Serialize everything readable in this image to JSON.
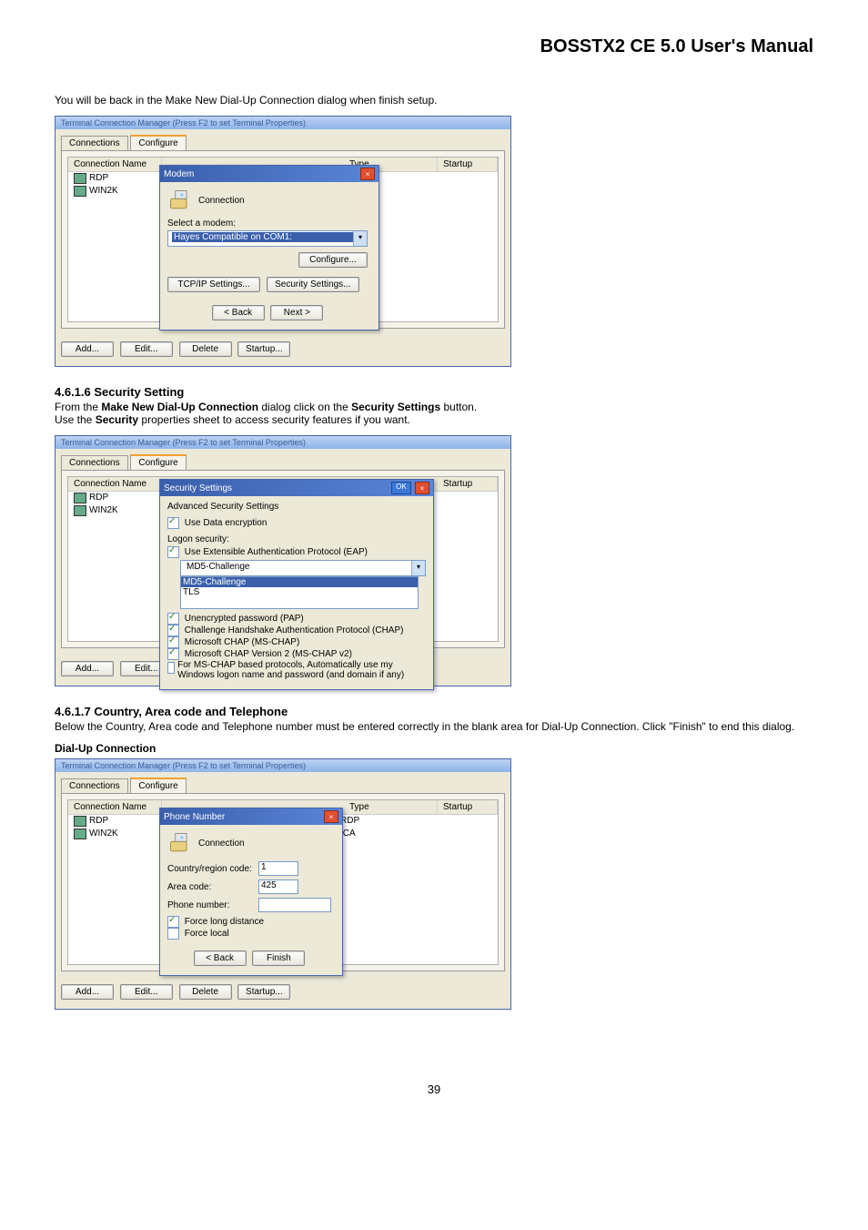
{
  "doc": {
    "title": "BOSSTX2 CE 5.0 User's Manual",
    "intro_text": "You will be back in the Make New Dial-Up Connection dialog when finish setup.",
    "page_number": "39"
  },
  "sec4616": {
    "heading": "4.6.1.6  Security Setting",
    "text1_prefix": "From the ",
    "text1_bold1": "Make New Dial-Up Connection",
    "text1_mid": " dialog click on the ",
    "text1_bold2": "Security Settings",
    "text1_suffix": " button.",
    "text2_prefix": "Use the ",
    "text2_bold": "Security",
    "text2_suffix": " properties sheet to access security features if you want."
  },
  "sec4617": {
    "heading": "4.6.1.7  Country, Area code and Telephone",
    "text": "Below the Country, Area code and Telephone number must be entered correctly in the blank area for Dial-Up Connection. Click \"Finish\" to end this dialog.",
    "subheading": "Dial-Up Connection"
  },
  "tcm": {
    "titlebar": "Terminal Connection Manager (Press F2 to set Terminal Properties)",
    "tabs": {
      "connections": "Connections",
      "configure": "Configure"
    },
    "headers": {
      "name": "Connection Name",
      "type": "Type",
      "startup": "Startup"
    },
    "rows": [
      {
        "name": "RDP",
        "type": "RDP"
      },
      {
        "name": "WIN2K",
        "type": "ICA"
      }
    ],
    "buttons": {
      "add": "Add...",
      "edit": "Edit...",
      "delete": "Delete",
      "startup": "Startup..."
    }
  },
  "modem_popup": {
    "title": "Modem",
    "label_connection": "Connection",
    "select_modem": "Select a modem:",
    "selected_modem": "Hayes Compatible on COM1:",
    "btn_configure": "Configure...",
    "btn_tcpip": "TCP/IP Settings...",
    "btn_security": "Security Settings...",
    "btn_back": "< Back",
    "btn_next": "Next >"
  },
  "security_popup": {
    "title": "Security Settings",
    "ok": "OK",
    "adv_label": "Advanced Security Settings",
    "chk_data_enc": "Use Data encryption",
    "logon_label": "Logon security:",
    "chk_eap": "Use Extensible Authentication Protocol (EAP)",
    "dropdown_sel": "MD5-Challenge",
    "list_items": [
      "MD5-Challenge",
      "TLS"
    ],
    "chk_pap": "Unencrypted password (PAP)",
    "chk_chap": "Challenge Handshake Authentication Protocol (CHAP)",
    "chk_mschap": "Microsoft CHAP (MS-CHAP)",
    "chk_mschap2": "Microsoft CHAP Version 2 (MS-CHAP v2)",
    "chk_auto": "For MS-CHAP based protocols, Automatically use my Windows logon name and password (and domain if any)"
  },
  "phone_popup": {
    "title": "Phone Number",
    "label_connection": "Connection",
    "lbl_country": "Country/region code:",
    "val_country": "1",
    "lbl_area": "Area code:",
    "val_area": "425",
    "lbl_phone": "Phone number:",
    "val_phone": "",
    "chk_longdist": "Force long distance",
    "chk_local": "Force local",
    "btn_back": "< Back",
    "btn_finish": "Finish"
  }
}
